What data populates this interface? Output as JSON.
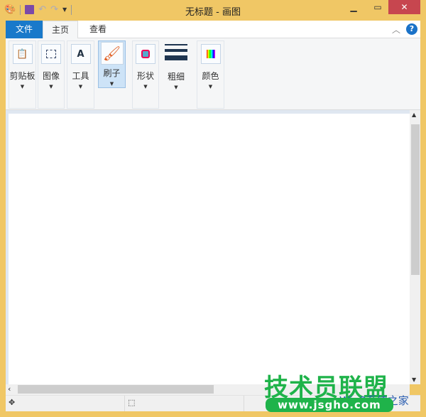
{
  "title": "无标题 - 画图",
  "tabs": {
    "file": "文件",
    "home": "主页",
    "view": "查看"
  },
  "groups": [
    {
      "label": "剪贴板",
      "icon": "clipboard-icon"
    },
    {
      "label": "图像",
      "icon": "select-icon"
    },
    {
      "label": "工具",
      "icon": "tools-icon"
    },
    {
      "label": "刷子",
      "icon": "brush-icon"
    },
    {
      "label": "形状",
      "icon": "shapes-icon"
    },
    {
      "label": "粗细",
      "icon": "line-size-icon"
    },
    {
      "label": "颜色",
      "icon": "colors-icon"
    }
  ],
  "watermark": {
    "text": "技术员联盟",
    "url": "www.jsgho.com",
    "sub": "Win8系统之家"
  },
  "colors": {
    "border": "#f0c765",
    "file_tab": "#1979ca",
    "close": "#c7464f"
  }
}
